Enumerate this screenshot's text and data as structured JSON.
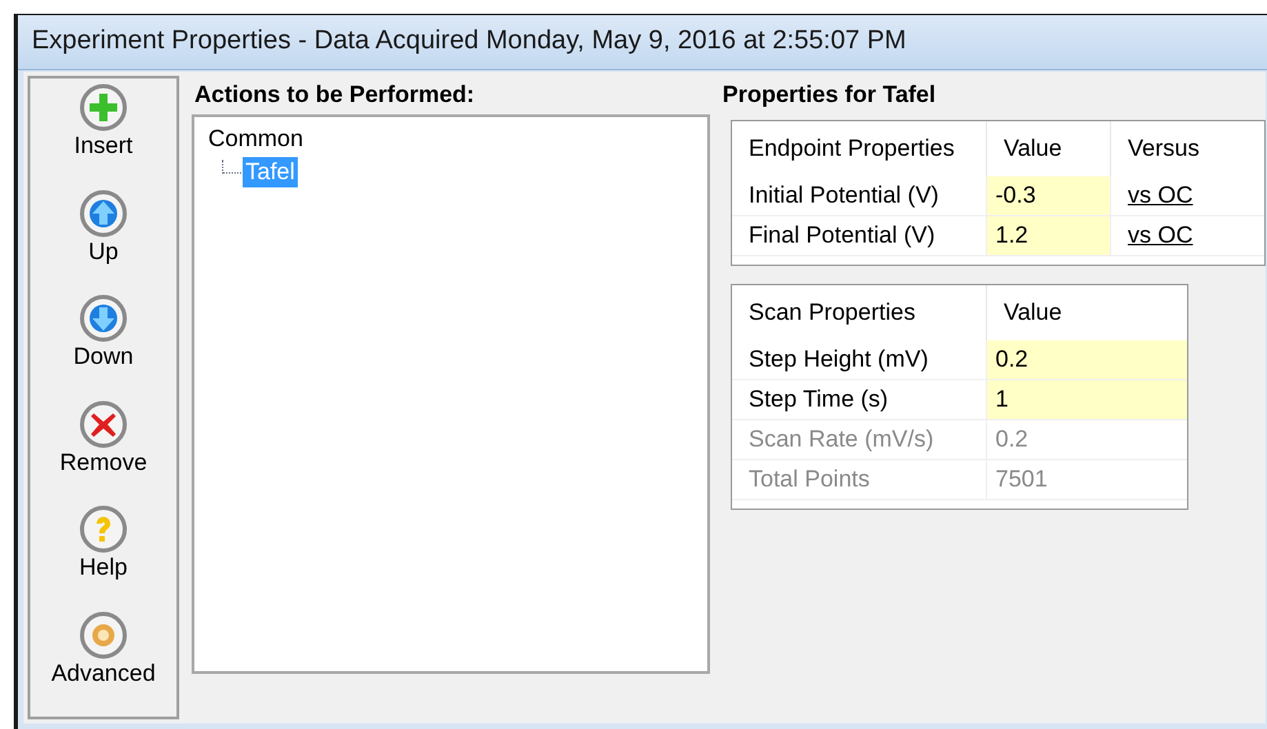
{
  "window": {
    "title": "Experiment Properties - Data Acquired Monday, May 9, 2016 at 2:55:07 PM"
  },
  "toolbar": [
    {
      "kind": "insert",
      "label": "Insert"
    },
    {
      "kind": "up",
      "label": "Up"
    },
    {
      "kind": "down",
      "label": "Down"
    },
    {
      "kind": "remove",
      "label": "Remove"
    },
    {
      "kind": "help",
      "label": "Help"
    },
    {
      "kind": "advanced",
      "label": "Advanced"
    }
  ],
  "actions": {
    "heading": "Actions to be Performed:",
    "tree": [
      {
        "label": "Common",
        "selected": false,
        "children": [
          {
            "label": "Tafel",
            "selected": true
          }
        ]
      }
    ]
  },
  "properties": {
    "heading": "Properties for Tafel",
    "endpoint_table": {
      "columns": [
        "Endpoint Properties",
        "Value",
        "Versus"
      ],
      "rows": [
        {
          "name": "Initial Potential (V)",
          "value": "-0.3",
          "versus": "vs OC",
          "editable": true
        },
        {
          "name": "Final Potential (V)",
          "value": "1.2",
          "versus": "vs OC",
          "editable": true
        }
      ]
    },
    "scan_table": {
      "columns": [
        "Scan Properties",
        "Value"
      ],
      "rows": [
        {
          "name": "Step Height (mV)",
          "value": "0.2",
          "editable": true
        },
        {
          "name": "Step Time (s)",
          "value": "1",
          "editable": true
        },
        {
          "name": "Scan Rate (mV/s)",
          "value": "0.2",
          "editable": false
        },
        {
          "name": "Total Points",
          "value": "7501",
          "editable": false
        }
      ]
    }
  }
}
